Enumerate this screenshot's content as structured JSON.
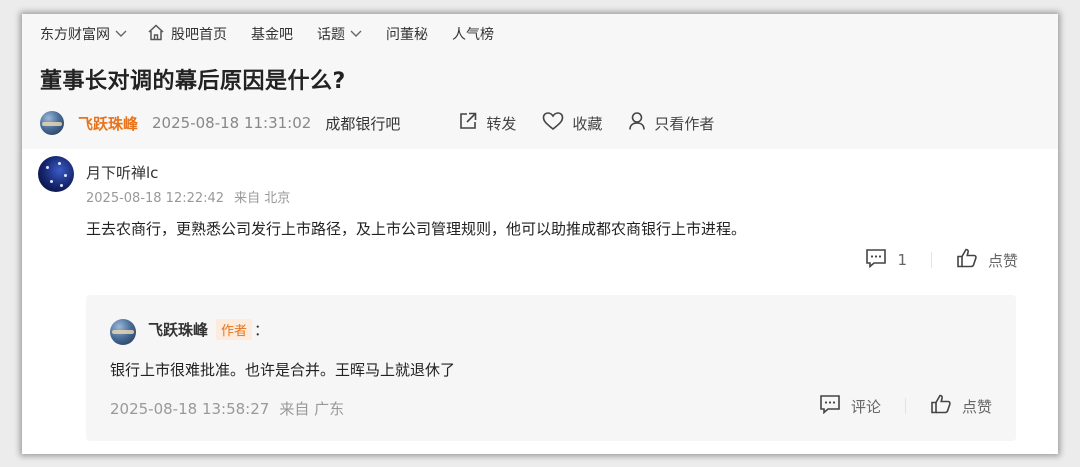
{
  "nav": {
    "items": [
      {
        "label": "东方财富网",
        "has_dropdown": true
      },
      {
        "label": "股吧首页",
        "icon": "home-icon"
      },
      {
        "label": "基金吧"
      },
      {
        "label": "话题",
        "has_dropdown": true
      },
      {
        "label": "问董秘"
      },
      {
        "label": "人气榜"
      }
    ]
  },
  "post": {
    "title": "董事长对调的幕后原因是什么?",
    "author": "飞跃珠峰",
    "datetime": "2025-08-18 11:31:02",
    "bar_name": "成都银行吧",
    "actions": {
      "share_label": "转发",
      "favorite_label": "收藏",
      "author_only_label": "只看作者"
    }
  },
  "comment": {
    "username": "月下听禅lc",
    "datetime": "2025-08-18 12:22:42",
    "location": "来自 北京",
    "text": "王去农商行，更熟悉公司发行上市路径，及上市公司管理规则，他可以助推成都农商银行上市进程。",
    "reply_count": "1",
    "like_label": "点赞"
  },
  "reply": {
    "username": "飞跃珠峰",
    "badge": "作者",
    "colon": "：",
    "text": "银行上市很难批准。也许是合并。王晖马上就退休了",
    "datetime": "2025-08-18 13:58:27",
    "location": "来自 广东",
    "comment_label": "评论",
    "like_label": "点赞"
  },
  "colors": {
    "author_orange": "#e8731c",
    "header_bg": "#f7f7f7",
    "reply_bg": "#f6f6f6",
    "muted_text": "#999999"
  }
}
